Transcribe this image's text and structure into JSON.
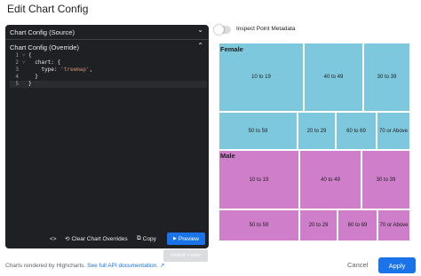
{
  "dialog": {
    "title": "Edit Chart Config"
  },
  "editor": {
    "source_label": "Chart Config (Source)",
    "override_label": "Chart Config (Override)",
    "code_lines": [
      {
        "num": "1",
        "fold": "˅",
        "text": "{"
      },
      {
        "num": "2",
        "fold": "˅",
        "text": "  chart: {"
      },
      {
        "num": "3",
        "fold": "",
        "text": "    type: ",
        "str": "'treemap'",
        "tail": ","
      },
      {
        "num": "4",
        "fold": "",
        "text": "  }"
      },
      {
        "num": "5",
        "fold": "",
        "text": "}"
      }
    ],
    "toolbar": {
      "format_icon": "<>",
      "clear_label": "Clear Chart Overrides",
      "copy_label": "Copy",
      "preview_label": "Preview",
      "preview_tooltip": "cmd/ctrl + enter"
    }
  },
  "inspect": {
    "label": "Inspect Point Metadata",
    "enabled": false
  },
  "treemap": {
    "colors": {
      "female": "#7ec8dd",
      "male": "#cf7ec9"
    },
    "groups": [
      {
        "name": "Female",
        "cells": [
          "10 to 19",
          "40 to 49",
          "30 to 39",
          "50 to 59",
          "20 to 29",
          "60 to 69",
          "70 or Above"
        ]
      },
      {
        "name": "Male",
        "cells": [
          "10 to 19",
          "40 to 49",
          "30 to 39",
          "50 to 59",
          "20 to 29",
          "60 to 69",
          "70 or Above"
        ]
      }
    ]
  },
  "footer": {
    "note": "Charts rendered by Highcharts.",
    "link": "See full API documentation.",
    "cancel_label": "Cancel",
    "apply_label": "Apply"
  }
}
